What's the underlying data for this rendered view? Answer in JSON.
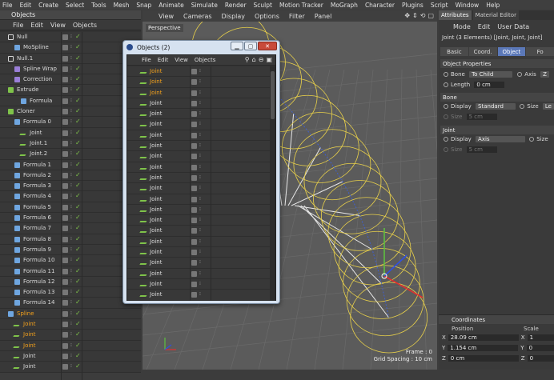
{
  "menubar": [
    "File",
    "Edit",
    "Create",
    "Select",
    "Tools",
    "Mesh",
    "Snap",
    "Animate",
    "Simulate",
    "Render",
    "Sculpt",
    "Motion Tracker",
    "MoGraph",
    "Character",
    "Plugins",
    "Script",
    "Window",
    "Help"
  ],
  "objmgr": {
    "title": "Objects",
    "menu": [
      "File",
      "Edit",
      "View",
      "Objects"
    ],
    "rows": [
      {
        "name": "Null",
        "indent": 0,
        "hl": false,
        "icon": "null"
      },
      {
        "name": "MoSpline",
        "indent": 1,
        "hl": false,
        "icon": "spline"
      },
      {
        "name": "Null.1",
        "indent": 0,
        "hl": false,
        "icon": "null"
      },
      {
        "name": "Spline Wrap",
        "indent": 1,
        "hl": false,
        "icon": "deformer"
      },
      {
        "name": "Correction",
        "indent": 1,
        "hl": false,
        "icon": "deformer"
      },
      {
        "name": "Extrude",
        "indent": 0,
        "hl": false,
        "icon": "generator"
      },
      {
        "name": "Formula",
        "indent": 2,
        "hl": false,
        "icon": "spline"
      },
      {
        "name": "Cloner",
        "indent": 0,
        "hl": false,
        "icon": "generator"
      },
      {
        "name": "Formula 0",
        "indent": 1,
        "hl": false,
        "icon": "spline"
      },
      {
        "name": "Joint",
        "indent": 2,
        "hl": false,
        "icon": "joint"
      },
      {
        "name": "Joint.1",
        "indent": 2,
        "hl": false,
        "icon": "joint"
      },
      {
        "name": "Joint.2",
        "indent": 2,
        "hl": false,
        "icon": "joint"
      },
      {
        "name": "Formula 1",
        "indent": 1,
        "hl": false,
        "icon": "spline"
      },
      {
        "name": "Formula 2",
        "indent": 1,
        "hl": false,
        "icon": "spline"
      },
      {
        "name": "Formula 3",
        "indent": 1,
        "hl": false,
        "icon": "spline"
      },
      {
        "name": "Formula 4",
        "indent": 1,
        "hl": false,
        "icon": "spline"
      },
      {
        "name": "Formula 5",
        "indent": 1,
        "hl": false,
        "icon": "spline"
      },
      {
        "name": "Formula 6",
        "indent": 1,
        "hl": false,
        "icon": "spline"
      },
      {
        "name": "Formula 7",
        "indent": 1,
        "hl": false,
        "icon": "spline"
      },
      {
        "name": "Formula 8",
        "indent": 1,
        "hl": false,
        "icon": "spline"
      },
      {
        "name": "Formula 9",
        "indent": 1,
        "hl": false,
        "icon": "spline"
      },
      {
        "name": "Formula 10",
        "indent": 1,
        "hl": false,
        "icon": "spline"
      },
      {
        "name": "Formula 11",
        "indent": 1,
        "hl": false,
        "icon": "spline"
      },
      {
        "name": "Formula 12",
        "indent": 1,
        "hl": false,
        "icon": "spline"
      },
      {
        "name": "Formula 13",
        "indent": 1,
        "hl": false,
        "icon": "spline"
      },
      {
        "name": "Formula 14",
        "indent": 1,
        "hl": false,
        "icon": "spline"
      },
      {
        "name": "Spline",
        "indent": 0,
        "hl": true,
        "icon": "spline"
      },
      {
        "name": "Joint",
        "indent": 1,
        "hl": true,
        "icon": "joint"
      },
      {
        "name": "Joint",
        "indent": 1,
        "hl": true,
        "icon": "joint"
      },
      {
        "name": "Joint",
        "indent": 1,
        "hl": true,
        "icon": "joint"
      },
      {
        "name": "Joint",
        "indent": 1,
        "hl": false,
        "icon": "joint"
      },
      {
        "name": "Joint",
        "indent": 1,
        "hl": false,
        "icon": "joint"
      }
    ]
  },
  "viewport": {
    "menu": [
      "View",
      "Cameras",
      "Display",
      "Options",
      "Filter",
      "Panel"
    ],
    "camera_label": "Perspective",
    "frame_label": "Frame : 0",
    "grid_label": "Grid Spacing : 10 cm"
  },
  "floatwin": {
    "title": "Objects (2)",
    "menu": [
      "File",
      "Edit",
      "View",
      "Objects"
    ],
    "rows": [
      "Joint",
      "Joint",
      "Joint",
      "Joint",
      "Joint",
      "Joint",
      "Joint",
      "Joint",
      "Joint",
      "Joint",
      "Joint",
      "Joint",
      "Joint",
      "Joint",
      "Joint",
      "Joint",
      "Joint",
      "Joint",
      "Joint",
      "Joint",
      "Joint",
      "Joint"
    ],
    "highlighted_count": 3
  },
  "attr": {
    "tabs": [
      "Attributes",
      "Material Editor"
    ],
    "menu": [
      "Mode",
      "Edit",
      "User Data"
    ],
    "title": "Joint (3 Elements) [Joint, Joint, Joint]",
    "mode_tabs": [
      "Basic",
      "Coord.",
      "Object",
      "Fo"
    ],
    "active_mode": "Object",
    "section_title": "Object Properties",
    "bone_label": "Bone",
    "bone_value": "To Child",
    "axis_label": "Axis",
    "axis_value": "Z",
    "length_label": "Length",
    "length_value": "0 cm",
    "bone_section": "Bone",
    "display_label": "Display",
    "bone_display_value": "Standard",
    "size_label": "Size",
    "size_value": "Le",
    "bone_size_label": "Size",
    "bone_size_value": "5 cm",
    "joint_section": "Joint",
    "joint_display_value": "Axis",
    "joint_size_label": "Size",
    "joint_size_value": "5 cm",
    "joint_size_suffix": "Size"
  },
  "coords": {
    "title": "Coordinates",
    "pos_header": "Position",
    "scale_header": "Scale",
    "rows": [
      {
        "axis": "X",
        "value": "28.09 cm",
        "saxis": "X",
        "svalue": "1"
      },
      {
        "axis": "Y",
        "value": "1.154 cm",
        "saxis": "Y",
        "svalue": "0"
      },
      {
        "axis": "Z",
        "value": "0 cm",
        "saxis": "Z",
        "svalue": "0"
      }
    ]
  },
  "colors": {
    "highlight": "#f3a11c",
    "active_tab": "#5b78b8",
    "check": "#7fc34a",
    "close_button": "#c84a3a"
  }
}
